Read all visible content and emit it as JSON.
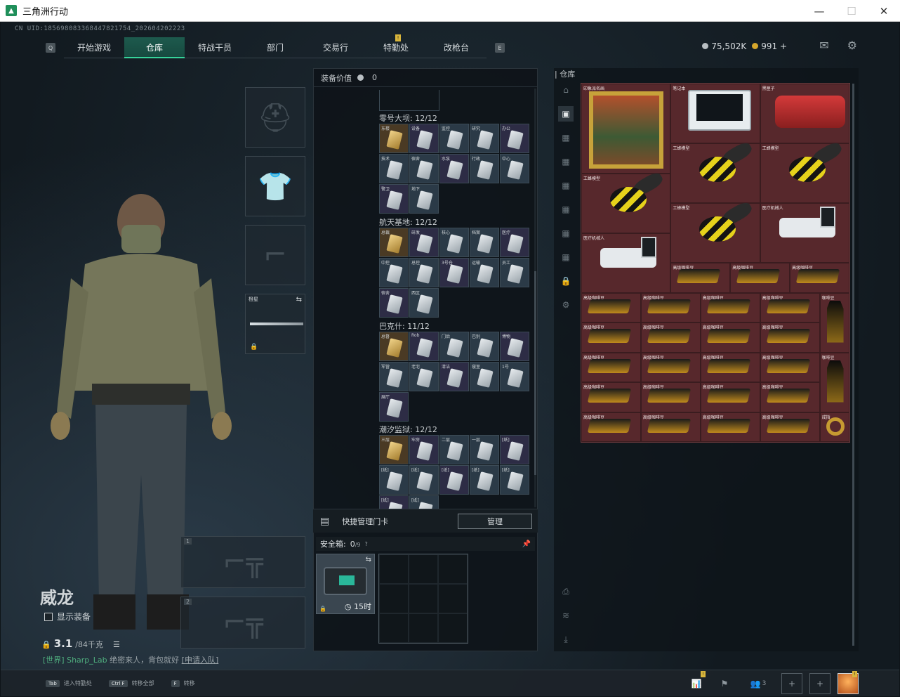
{
  "window": {
    "title": "三角洲行动"
  },
  "uid": "CN UID:1856980833684478217​54_202604202223",
  "nav": {
    "left_key": "Q",
    "right_key": "E",
    "tabs": [
      {
        "label": "开始游戏",
        "active": false
      },
      {
        "label": "仓库",
        "active": true
      },
      {
        "label": "特战干员",
        "active": false
      },
      {
        "label": "部门",
        "active": false
      },
      {
        "label": "交易行",
        "active": false
      },
      {
        "label": "特勤处",
        "active": false,
        "notification": "!"
      },
      {
        "label": "改枪台",
        "active": false
      }
    ]
  },
  "currency": {
    "silver": "75,502K",
    "gold": "991",
    "gold_plus": "+"
  },
  "operator": {
    "name": "威龙",
    "show_equipment_label": "显示装备",
    "weight_value": "3.1",
    "weight_max": "/84千克",
    "chat_prefix": "[世界]",
    "chat_user": "Sharp_Lab",
    "chat_text": "绝密来人，背包就好",
    "chat_link": "[申请入队]"
  },
  "equipment": {
    "melee_label": "橙星",
    "slot1_number": "1",
    "slot2_number": "2"
  },
  "middle": {
    "header_label": "装备价值",
    "header_value": "0",
    "sections": [
      {
        "title": "零号大坝: 12/12",
        "cards": [
          "东楼",
          "设备",
          "监控",
          "研究",
          "办公",
          "技术",
          "宿舍",
          "水泵",
          "行政",
          "中心",
          "警卫",
          "地下"
        ]
      },
      {
        "title": "航天基地: 12/12",
        "cards": [
          "总裁",
          "研发",
          "核心",
          "档案",
          "医疗",
          "中控",
          "总控",
          "3号仓",
          "运输",
          "员工",
          "宿舍",
          "西区"
        ]
      },
      {
        "title": "巴克什: 11/12",
        "cards": [
          "总督",
          "Rob",
          "门后",
          "巴别",
          "博物",
          "军营",
          "老宅",
          "清洁",
          "寝室",
          "1号",
          "展厅"
        ]
      },
      {
        "title": "潮汐监狱: 12/12",
        "cards": [
          "三层",
          "牢房",
          "二层",
          "一层",
          "[纸]",
          "[纸]",
          "[纸]",
          "[纸]",
          "[纸]",
          "[纸]",
          "[纸]",
          "[纸]"
        ]
      }
    ],
    "quick_card_label": "快捷管理门卡",
    "manage_button": "管理",
    "safe_box_label": "安全箱:",
    "safe_box_count": "0",
    "safe_box_max": "/9",
    "safe_box_help": "?",
    "safe_box_timer": "15时"
  },
  "storage": {
    "title": "仓库",
    "items": [
      {
        "name": "印象派名画",
        "type": "painting"
      },
      {
        "name": "笔记本",
        "type": "laptop"
      },
      {
        "name": "黑匣子",
        "type": "mask"
      },
      {
        "name": "工蜂模型",
        "type": "bee"
      },
      {
        "name": "工蜂模型",
        "type": "bee"
      },
      {
        "name": "工蜂模型",
        "type": "bee"
      },
      {
        "name": "工蜂模型",
        "type": "bee"
      },
      {
        "name": "医疗机械人",
        "type": "arm"
      },
      {
        "name": "医疗机械人",
        "type": "arm"
      }
    ],
    "pc_label": "高级咖啡豆",
    "bag_label": "咖啡豆",
    "ring_label": "戒指"
  },
  "bottom_hints": [
    {
      "key": "Tab",
      "label": "进入特勤处"
    },
    {
      "key": "Ctrl F",
      "label": "转移全部"
    },
    {
      "key": "F",
      "label": "转移"
    }
  ],
  "bottom_right": {
    "team_count": "3",
    "plus1": "+",
    "plus2": "+"
  },
  "colors": {
    "accent": "#36d39a",
    "active_tab": "#1d5a4d",
    "storage_bg": "#5a2a2d",
    "notification": "#d9b53b"
  }
}
